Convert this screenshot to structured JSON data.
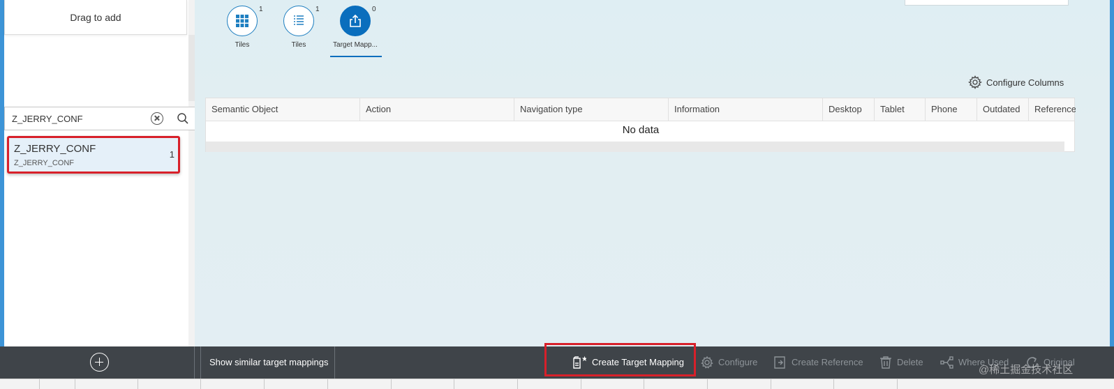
{
  "left_panel": {
    "drag_label": "Drag to add",
    "search_value": "Z_JERRY_CONF",
    "list_items": [
      {
        "title": "Z_JERRY_CONF",
        "subtitle": "Z_JERRY_CONF",
        "count": "1"
      }
    ]
  },
  "tabs": [
    {
      "label": "Tiles",
      "count": "1",
      "icon": "grid-icon"
    },
    {
      "label": "Tiles",
      "count": "1",
      "icon": "list-icon"
    },
    {
      "label": "Target Mapp...",
      "count": "0",
      "icon": "share-icon"
    }
  ],
  "configure_columns_label": "Configure Columns",
  "table": {
    "columns": [
      "Semantic Object",
      "Action",
      "Navigation type",
      "Information",
      "Desktop",
      "Tablet",
      "Phone",
      "Outdated",
      "Reference"
    ],
    "empty_text": "No data"
  },
  "footer": {
    "show_similar": "Show similar target mappings",
    "create_target_mapping": "Create Target Mapping",
    "configure": "Configure",
    "create_reference": "Create Reference",
    "delete": "Delete",
    "where_used": "Where Used",
    "original": "Original"
  },
  "watermark": "@稀土掘金技术社区",
  "colors": {
    "accent": "#0a6ebd",
    "highlight": "#d8202a",
    "footer_bg": "#3f4449",
    "window_border": "#3d94d7"
  }
}
